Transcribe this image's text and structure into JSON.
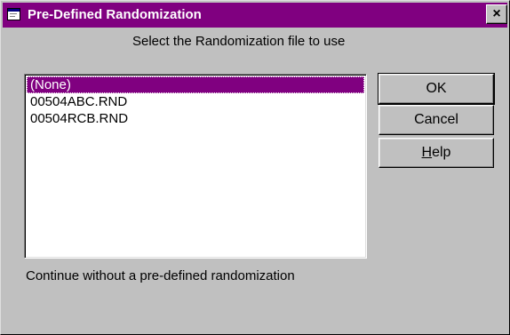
{
  "window": {
    "title": "Pre-Defined Randomization",
    "title_icon": "dialog-window-icon",
    "close_label": "×"
  },
  "prompt": "Select the Randomization file to use",
  "list": {
    "items": [
      {
        "label": "(None)",
        "selected": true
      },
      {
        "label": "00504ABC.RND",
        "selected": false
      },
      {
        "label": "00504RCB.RND",
        "selected": false
      }
    ]
  },
  "buttons": {
    "ok": "OK",
    "cancel": "Cancel",
    "help_mnemonic": "H",
    "help_rest": "elp"
  },
  "status_text": "Continue without a pre-defined randomization",
  "colors": {
    "titlebar": "#800080",
    "selection": "#800080",
    "face": "#c0c0c0"
  }
}
